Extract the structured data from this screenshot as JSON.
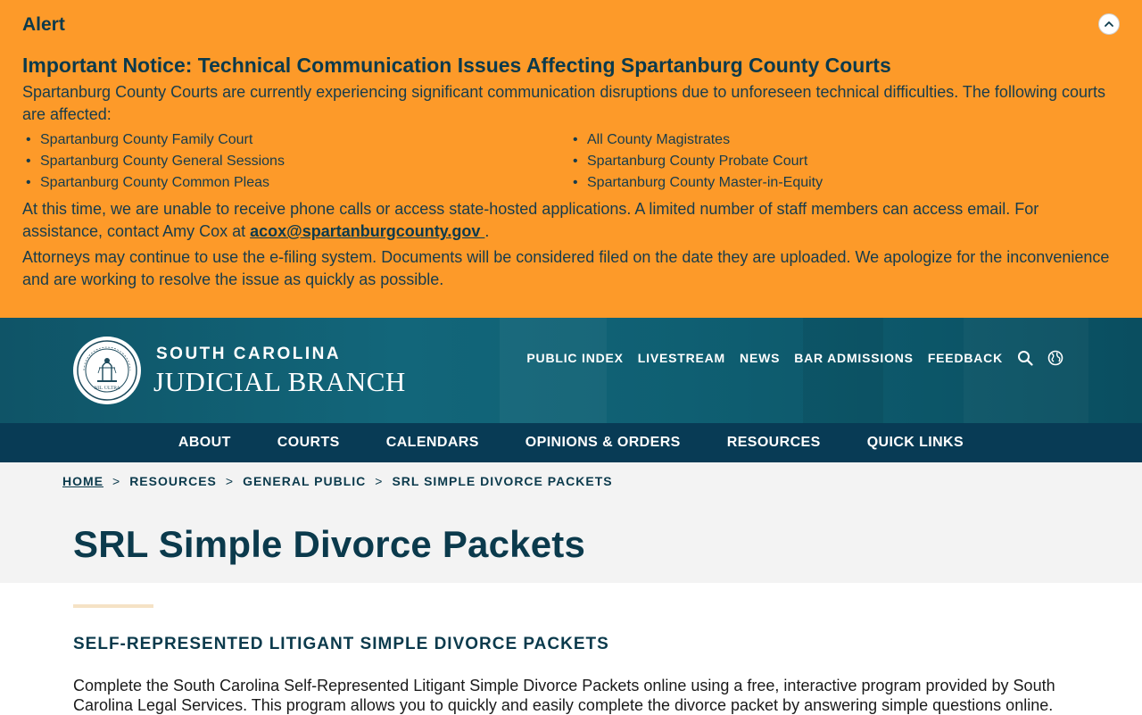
{
  "alert": {
    "label": "Alert",
    "title": "Important Notice: Technical Communication Issues Affecting Spartanburg County Courts",
    "intro": "Spartanburg County Courts are currently experiencing significant communication disruptions due to unforeseen technical difficulties. The following courts are affected:",
    "courts_left": [
      "Spartanburg County Family Court",
      "Spartanburg County General Sessions",
      "Spartanburg County Common Pleas"
    ],
    "courts_right": [
      "All County Magistrates",
      "Spartanburg County Probate Court",
      "Spartanburg County Master-in-Equity"
    ],
    "contact_text": "At this time, we are unable to receive phone calls or access state-hosted applications. A limited number of staff members can access email. For assistance, contact Amy Cox at ",
    "contact_email": "acox@spartanburgcounty.gov ",
    "contact_end": ".",
    "efiling_text": "Attorneys may continue to use the e-filing system. Documents will be considered filed on the date they are uploaded. We apologize for the inconvenience and are working to resolve the issue as quickly as possible.",
    "collapse_icon": "chevron-up-icon",
    "background_color": "#fd9a29"
  },
  "header": {
    "brand_top": "SOUTH CAROLINA",
    "brand_bottom": "JUDICIAL BRANCH",
    "seal_icon": "supreme-court-seal-icon",
    "seal_motto": "NIL ULTRA",
    "util_links": [
      "PUBLIC INDEX",
      "LIVESTREAM",
      "NEWS",
      "BAR ADMISSIONS",
      "FEEDBACK"
    ],
    "search_icon": "search-icon",
    "language_icon": "globe-icon"
  },
  "nav": {
    "items": [
      "ABOUT",
      "COURTS",
      "CALENDARS",
      "OPINIONS & ORDERS",
      "RESOURCES",
      "QUICK LINKS"
    ]
  },
  "breadcrumb": {
    "home": "HOME",
    "resources": "RESOURCES",
    "general_public": "GENERAL PUBLIC",
    "current": "SRL SIMPLE DIVORCE PACKETS",
    "separator": ">"
  },
  "page": {
    "title": "SRL Simple Divorce Packets",
    "section_heading": "SELF-REPRESENTED LITIGANT SIMPLE DIVORCE PACKETS",
    "body": "Complete the South Carolina Self-Represented Litigant Simple Divorce Packets online using a free, interactive program provided by South Carolina Legal Services. This program allows you to quickly and easily complete the divorce packet by answering simple questions online."
  },
  "colors": {
    "navy": "#0b3a4c",
    "nav_bar": "#083b55",
    "header_teal": "#12667a",
    "title_band": "#f3f3f3"
  }
}
